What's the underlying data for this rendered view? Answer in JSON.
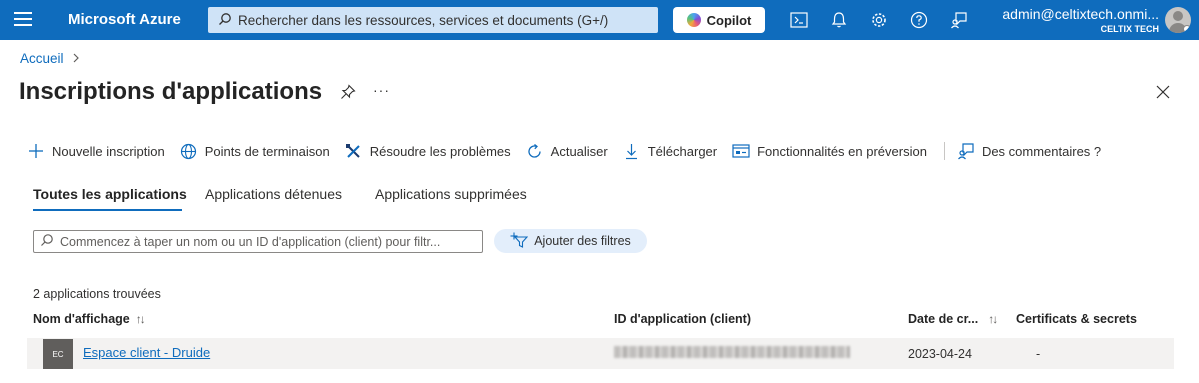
{
  "header": {
    "brand": "Microsoft Azure",
    "search_placeholder": "Rechercher dans les ressources, services et documents (G+/)",
    "copilot_label": "Copilot",
    "account_email": "admin@celtixtech.onmi...",
    "account_tenant": "CELTIX TECH",
    "icons": [
      "cloud-shell-icon",
      "bell-icon",
      "gear-icon",
      "help-icon",
      "feedback-icon"
    ]
  },
  "breadcrumb": {
    "home": "Accueil"
  },
  "page": {
    "title": "Inscriptions d'applications",
    "more": "···"
  },
  "toolbar": {
    "new_registration": "Nouvelle inscription",
    "endpoints": "Points de terminaison",
    "troubleshoot": "Résoudre les problèmes",
    "refresh": "Actualiser",
    "download": "Télécharger",
    "preview_features": "Fonctionnalités en préversion",
    "feedback": "Des commentaires ?"
  },
  "tabs": [
    {
      "label": "Toutes les applications",
      "active": true
    },
    {
      "label": "Applications détenues",
      "active": false
    },
    {
      "label": "Applications supprimées",
      "active": false
    }
  ],
  "filter": {
    "placeholder": "Commencez à taper un nom ou un ID d'application (client) pour filtr...",
    "add_filters": "Ajouter des filtres"
  },
  "table": {
    "count_text": "2 applications trouvées",
    "columns": {
      "display_name": "Nom d'affichage",
      "app_id": "ID d'application (client)",
      "created": "Date de cr...",
      "certs": "Certificats & secrets"
    },
    "sort_glyph": "↑↓",
    "rows": [
      {
        "initials": "EC",
        "name": "Espace client - Druide",
        "app_id": "",
        "created": "2023-04-24",
        "certs": "-"
      }
    ]
  },
  "colors": {
    "brand": "#0f6cbd",
    "row_bg": "#f3f2f1"
  }
}
